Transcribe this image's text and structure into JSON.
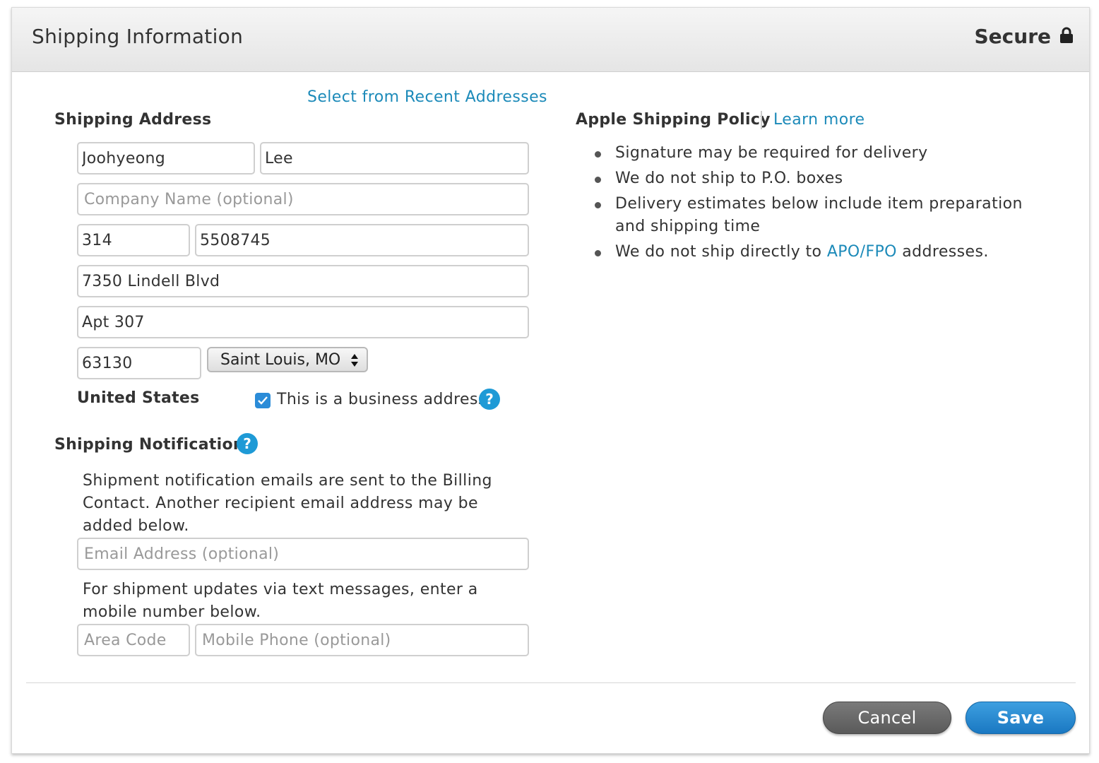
{
  "header": {
    "title": "Shipping Information",
    "secure_label": "Secure"
  },
  "address": {
    "recent_link": "Select from Recent Addresses",
    "section_label": "Shipping Address",
    "first_name": "Joohyeong",
    "last_name": "Lee",
    "company_placeholder": "Company Name (optional)",
    "area_code": "314",
    "phone": "5508745",
    "street": "7350 Lindell Blvd",
    "street2": "Apt 307",
    "zip": "63130",
    "city_state": "Saint Louis, MO",
    "country": "United States",
    "business_label": "This is a business address",
    "business_checked": true
  },
  "notifications": {
    "section_label": "Shipping Notifications",
    "email_note": "Shipment notification emails are sent to the Billing Contact. Another recipient email address may be added below.",
    "email_placeholder": "Email Address (optional)",
    "sms_note": "For shipment updates via text messages, enter a mobile number below.",
    "area_code_placeholder": "Area Code",
    "mobile_placeholder": "Mobile Phone (optional)"
  },
  "policy": {
    "title": "Apple Shipping Policy",
    "learn_more": "Learn more",
    "items": [
      "Signature may be required for delivery",
      "We do not ship to P.O. boxes",
      "Delivery estimates below include item preparation and shipping time"
    ],
    "apo_prefix": "We do not ship directly to ",
    "apo_link": "APO/FPO",
    "apo_suffix": " addresses."
  },
  "footer": {
    "cancel_label": "Cancel",
    "save_label": "Save"
  },
  "colors": {
    "link": "#1c8ab9",
    "save_button": "#1a78c2",
    "cancel_button": "#5a5a5a",
    "checkbox": "#2b8cd8"
  },
  "icons": [
    "lock-icon",
    "help-icon",
    "checkmark-icon",
    "select-arrows-icon"
  ]
}
